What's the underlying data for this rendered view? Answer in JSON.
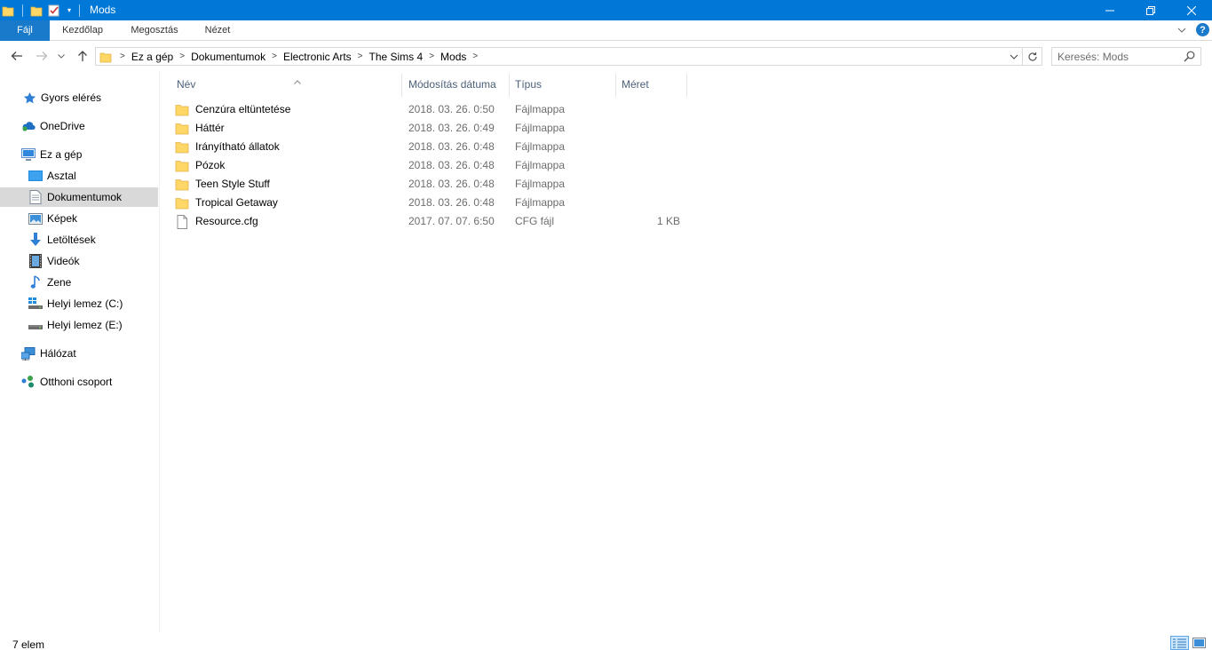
{
  "window": {
    "title": "Mods"
  },
  "ribbon": {
    "tabs": [
      {
        "label": "Fájl"
      },
      {
        "label": "Kezdőlap"
      },
      {
        "label": "Megosztás"
      },
      {
        "label": "Nézet"
      }
    ]
  },
  "address": {
    "breadcrumbs": [
      "Ez a gép",
      "Dokumentumok",
      "Electronic Arts",
      "The Sims 4",
      "Mods"
    ]
  },
  "search": {
    "placeholder": "Keresés: Mods"
  },
  "navpane": {
    "items": [
      {
        "label": "Gyors elérés",
        "icon": "star-icon"
      },
      {
        "label": "OneDrive",
        "icon": "cloud-icon"
      },
      {
        "label": "Ez a gép",
        "icon": "computer-icon"
      },
      {
        "label": "Asztal",
        "icon": "desktop-icon"
      },
      {
        "label": "Dokumentumok",
        "icon": "documents-icon",
        "selected": true
      },
      {
        "label": "Képek",
        "icon": "pictures-icon"
      },
      {
        "label": "Letöltések",
        "icon": "download-icon"
      },
      {
        "label": "Videók",
        "icon": "video-icon"
      },
      {
        "label": "Zene",
        "icon": "music-icon"
      },
      {
        "label": "Helyi lemez (C:)",
        "icon": "windows-drive-icon"
      },
      {
        "label": "Helyi lemez (E:)",
        "icon": "drive-icon"
      },
      {
        "label": "Hálózat",
        "icon": "network-icon"
      },
      {
        "label": "Otthoni csoport",
        "icon": "homegroup-icon"
      }
    ]
  },
  "columns": {
    "name": "Név",
    "modified": "Módosítás dátuma",
    "type": "Típus",
    "size": "Méret"
  },
  "files": [
    {
      "name": "Cenzúra eltüntetése",
      "modified": "2018. 03. 26. 0:50",
      "type": "Fájlmappa",
      "size": "",
      "icon": "folder-icon"
    },
    {
      "name": "Háttér",
      "modified": "2018. 03. 26. 0:49",
      "type": "Fájlmappa",
      "size": "",
      "icon": "folder-icon"
    },
    {
      "name": "Irányítható állatok",
      "modified": "2018. 03. 26. 0:48",
      "type": "Fájlmappa",
      "size": "",
      "icon": "folder-icon"
    },
    {
      "name": "Pózok",
      "modified": "2018. 03. 26. 0:48",
      "type": "Fájlmappa",
      "size": "",
      "icon": "folder-icon"
    },
    {
      "name": "Teen Style Stuff",
      "modified": "2018. 03. 26. 0:48",
      "type": "Fájlmappa",
      "size": "",
      "icon": "folder-icon"
    },
    {
      "name": "Tropical Getaway",
      "modified": "2018. 03. 26. 0:48",
      "type": "Fájlmappa",
      "size": "",
      "icon": "folder-icon"
    },
    {
      "name": "Resource.cfg",
      "modified": "2017. 07. 07. 6:50",
      "type": "CFG fájl",
      "size": "1 KB",
      "icon": "file-icon"
    }
  ],
  "status": {
    "count": "7 elem"
  },
  "colors": {
    "titlebar": "#0078d7",
    "file_tab": "#1979ca",
    "selected_nav": "#d9d9d9",
    "folder": "#ffd766"
  }
}
